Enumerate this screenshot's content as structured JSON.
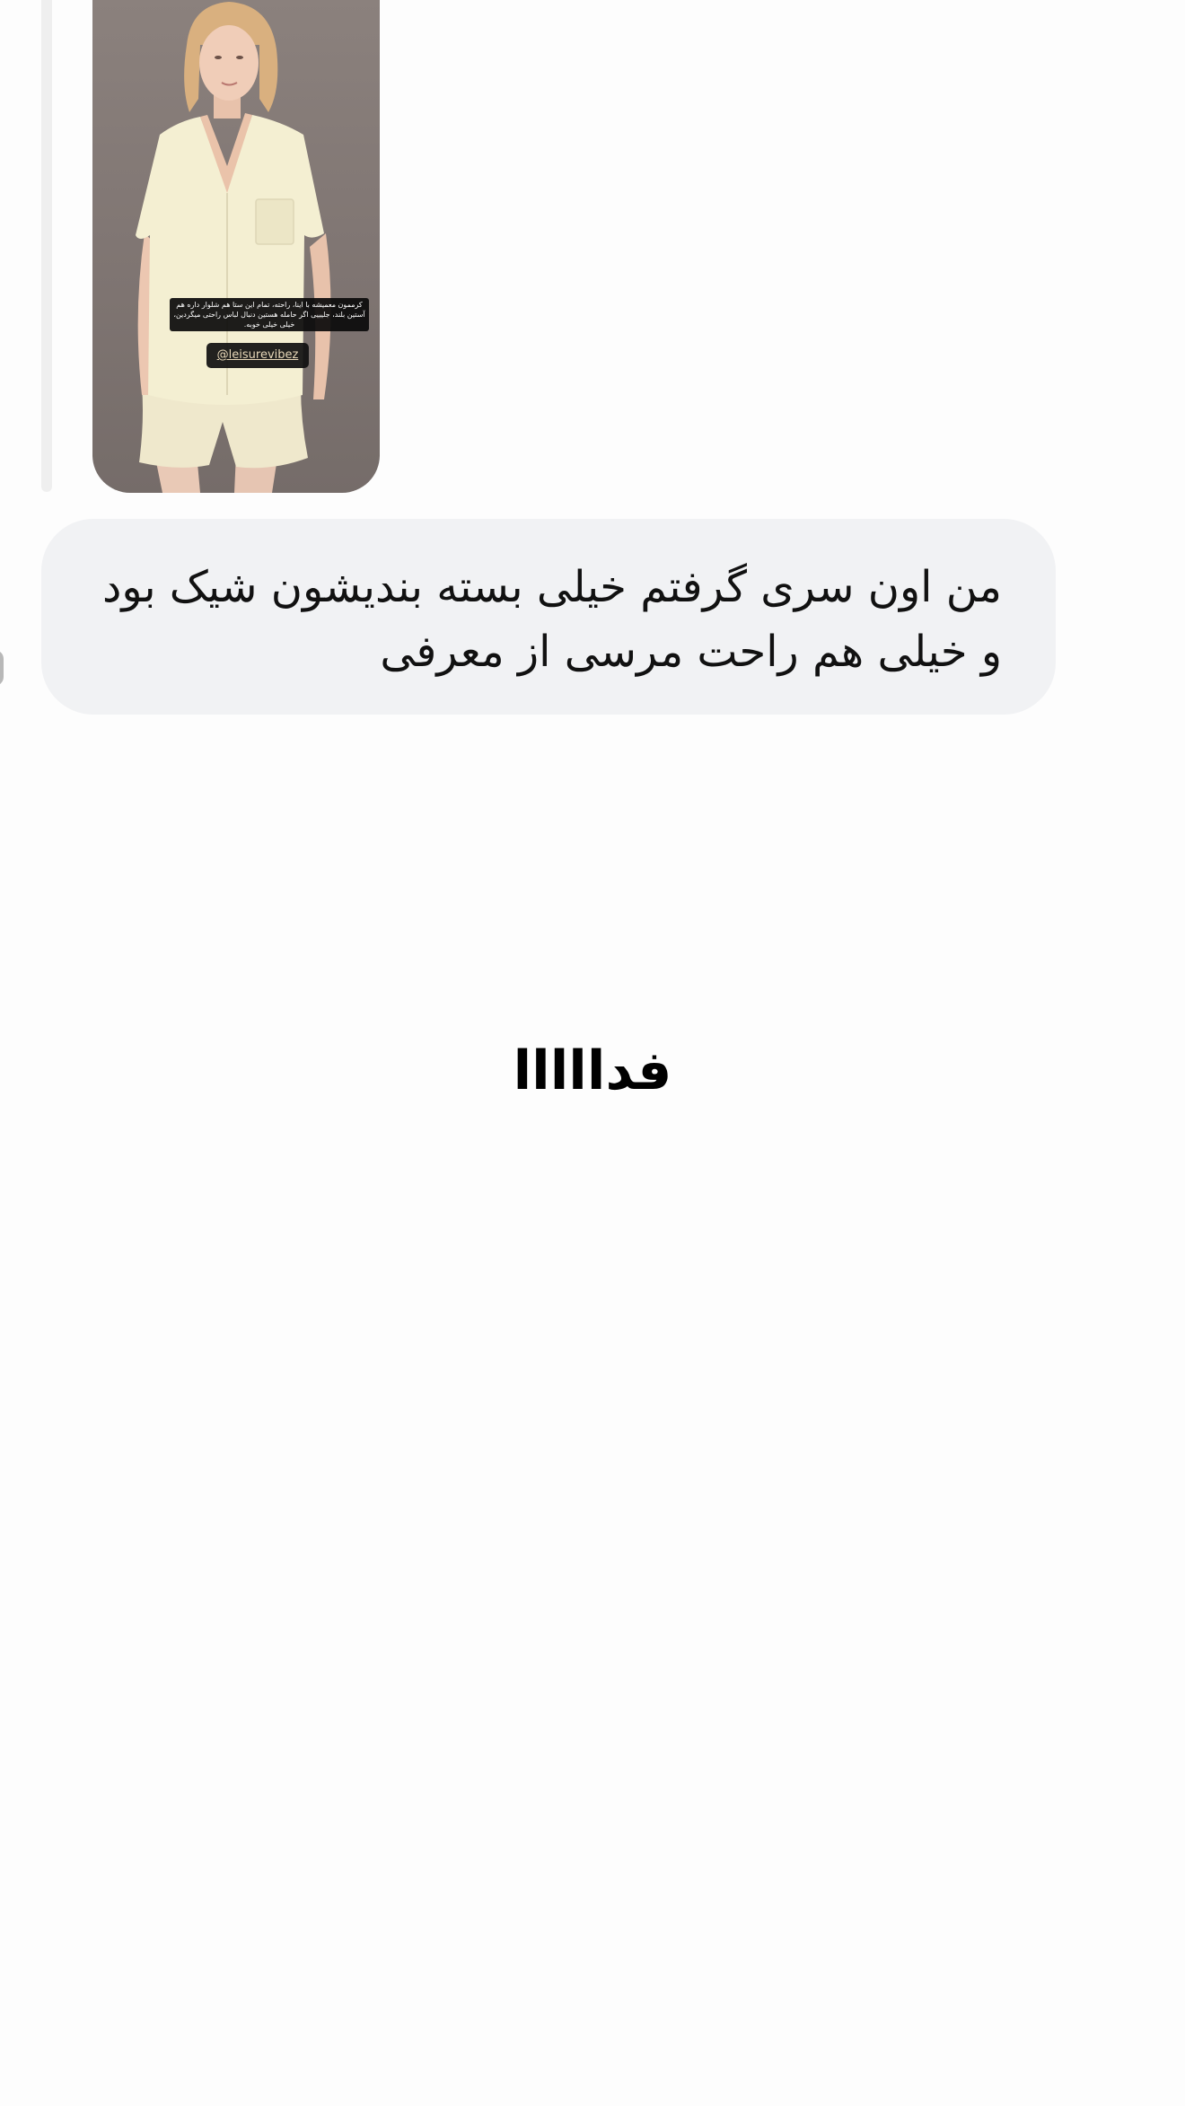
{
  "story_reply": {
    "caption": "کرممون معمیشه با اینا، راحته، تمام این ستا هم شلوار داره هم آستین بلند، جلیییی اگر حامله هستین دنبال لباس راحتی میگردین، خیلی خیلی خوبه.",
    "mention": "@leisurevibez",
    "image_icon": "story-image-woman-in-cream-pajamas"
  },
  "message": {
    "text": "من اون سری گرفتم خیلی بسته بندیشون شیک بود و خیلی هم راحت مرسی از معرفی",
    "bubble_color": "#f1f2f4"
  },
  "reaction_message": {
    "text": "فدااااا"
  },
  "colors": {
    "background": "#fdfdfd",
    "reply_bar": "#efefef",
    "text": "#111111"
  }
}
